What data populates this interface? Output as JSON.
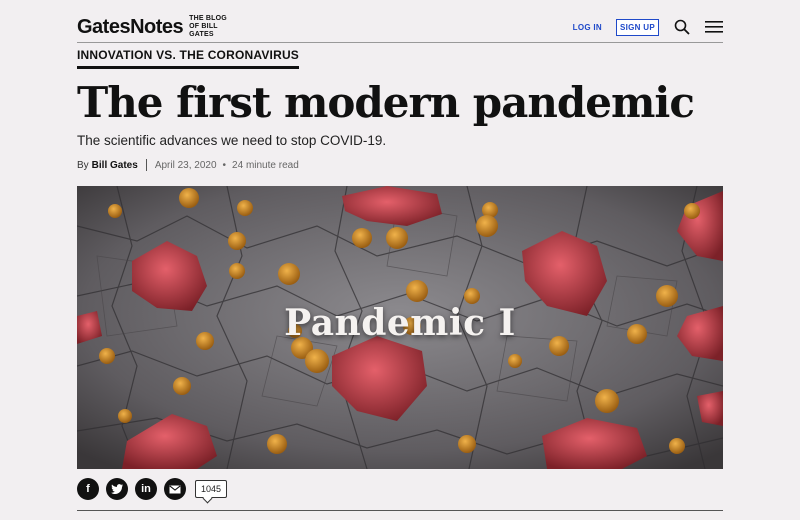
{
  "header": {
    "logo": "GatesNotes",
    "tagline": "THE BLOG OF BILL GATES",
    "login_label": "LOG IN",
    "signup_label": "SIGN UP",
    "accent_color": "#1f49c9"
  },
  "article": {
    "kicker": "INNOVATION VS. THE CORONAVIRUS",
    "title": "The first modern pandemic",
    "subtitle": "The scientific advances we need to stop COVID-19.",
    "byline_prefix": "By",
    "author": "Bill Gates",
    "date": "April 23, 2020",
    "separator": "•",
    "read_time": "24 minute read",
    "hero_title": "Pandemic I"
  },
  "share": {
    "icons": [
      "facebook-icon",
      "twitter-icon",
      "linkedin-icon",
      "email-icon"
    ],
    "facebook_glyph": "f",
    "linkedin_glyph": "in",
    "comment_count": "1045"
  }
}
